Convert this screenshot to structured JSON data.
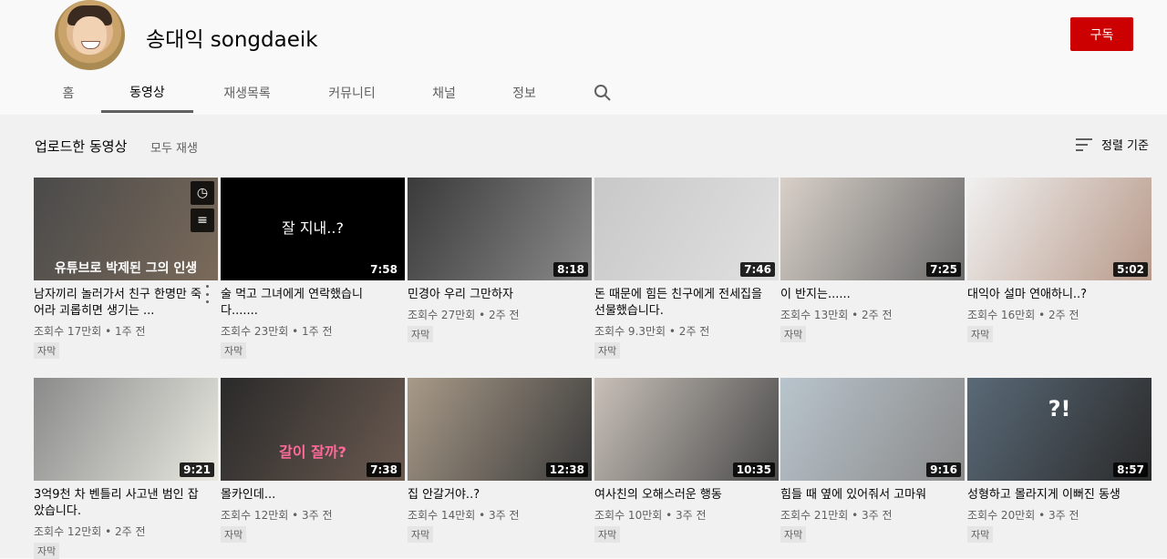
{
  "channel": {
    "name": "송대익 songdaeik",
    "subscribe_label": "구독"
  },
  "tabs": [
    "홈",
    "동영상",
    "재생목록",
    "커뮤니티",
    "채널",
    "정보"
  ],
  "section": {
    "title": "업로드한 동영상",
    "play_all": "모두 재생",
    "sort_label": "정렬 기준"
  },
  "videos": [
    {
      "title": "남자끼리 놀러가서 친구 한명만 죽어라 괴롭히면 생기는 ...",
      "meta": "조회수 17만회 • 1주 전",
      "badge": "자막",
      "duration": "",
      "overlay": "유튜브로 박제된 그의 인생",
      "colors": [
        "#4a4a4a",
        "#7a6a5a"
      ]
    },
    {
      "title": "술 먹고 그녀에게 연락했습니다.......",
      "meta": "조회수 23만회 • 1주 전",
      "badge": "자막",
      "duration": "7:58",
      "overlay": "잘 지내..?",
      "colors": [
        "#000000",
        "#000000"
      ]
    },
    {
      "title": "민경아 우리 그만하자",
      "meta": "조회수 27만회 • 2주 전",
      "badge": "자막",
      "duration": "8:18",
      "overlay": "",
      "colors": [
        "#3a3a3a",
        "#8a8a8a"
      ]
    },
    {
      "title": "돈 때문에 힘든 친구에게 전세집을 선물했습니다.",
      "meta": "조회수 9.3만회 • 2주 전",
      "badge": "자막",
      "duration": "7:46",
      "overlay": "",
      "colors": [
        "#c8c8c8",
        "#e0e0e0"
      ]
    },
    {
      "title": "이 반지는......",
      "meta": "조회수 13만회 • 2주 전",
      "badge": "자막",
      "duration": "7:25",
      "overlay": "",
      "colors": [
        "#d8d0c8",
        "#6a6a6a"
      ]
    },
    {
      "title": "대익아 설마 연애하니..?",
      "meta": "조회수 16만회 • 2주 전",
      "badge": "자막",
      "duration": "5:02",
      "overlay": "",
      "colors": [
        "#f0f0f0",
        "#b89a8a"
      ]
    },
    {
      "title": "3억9천 차 벤틀리 사고낸 범인 잡았습니다.",
      "meta": "조회수 12만회 • 2주 전",
      "badge": "자막",
      "duration": "9:21",
      "overlay": "",
      "colors": [
        "#8a8a8a",
        "#e8e8e0"
      ]
    },
    {
      "title": "몰카인데...",
      "meta": "조회수 12만회 • 3주 전",
      "badge": "자막",
      "duration": "7:38",
      "overlay": "갈이 잘까?",
      "colors": [
        "#2a2a2a",
        "#6a5a50"
      ]
    },
    {
      "title": "집 안갈거야..?",
      "meta": "조회수 14만회 • 3주 전",
      "badge": "자막",
      "duration": "12:38",
      "overlay": "",
      "colors": [
        "#a89a88",
        "#3a3a3a"
      ]
    },
    {
      "title": "여사친의 오해스러운 행동",
      "meta": "조회수 10만회 • 3주 전",
      "badge": "자막",
      "duration": "10:35",
      "overlay": "",
      "colors": [
        "#c8c0b8",
        "#4a4a4a"
      ]
    },
    {
      "title": "힘들 때 옆에 있어줘서 고마워",
      "meta": "조회수 21만회 • 3주 전",
      "badge": "자막",
      "duration": "9:16",
      "overlay": "",
      "colors": [
        "#b8c4cc",
        "#8a8a8a"
      ]
    },
    {
      "title": "성형하고 몰라지게 이뻐진 동생",
      "meta": "조회수 20만회 • 3주 전",
      "badge": "자막",
      "duration": "8:57",
      "overlay": "?!",
      "colors": [
        "#5a6a78",
        "#2a2a2a"
      ]
    }
  ]
}
